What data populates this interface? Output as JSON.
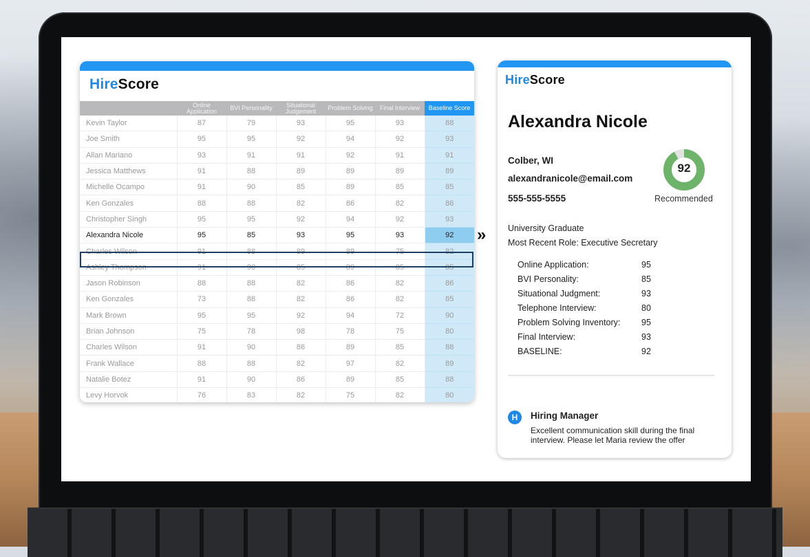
{
  "brand": {
    "hire": "Hire",
    "score": "Score"
  },
  "table": {
    "headers": [
      "Online Application",
      "BVI Personality",
      "Situational Judgement",
      "Problem Solving",
      "Final Interview",
      "Baseline Score"
    ],
    "rows": [
      [
        "Kevin Taylor",
        "87",
        "79",
        "93",
        "95",
        "93",
        "88"
      ],
      [
        "Joe Smith",
        "95",
        "95",
        "92",
        "94",
        "92",
        "93"
      ],
      [
        "Allan Mariano",
        "93",
        "91",
        "91",
        "92",
        "91",
        "91"
      ],
      [
        "Jessica Matthews",
        "91",
        "88",
        "89",
        "89",
        "89",
        "89"
      ],
      [
        "Michelle Ocampo",
        "91",
        "90",
        "85",
        "89",
        "85",
        "85"
      ],
      [
        "Ken Gonzales",
        "88",
        "88",
        "82",
        "86",
        "82",
        "86"
      ],
      [
        "Christopher Singh",
        "95",
        "95",
        "92",
        "94",
        "92",
        "93"
      ],
      [
        "Alexandra Nicole",
        "95",
        "85",
        "93",
        "95",
        "93",
        "92"
      ],
      [
        "Charles Wilson",
        "91",
        "88",
        "89",
        "89",
        "75",
        "82"
      ],
      [
        "Ashley Thompson",
        "91",
        "90",
        "85",
        "89",
        "85",
        "85"
      ],
      [
        "Jason Robinson",
        "88",
        "88",
        "82",
        "86",
        "82",
        "86"
      ],
      [
        "Ken Gonzales",
        "73",
        "88",
        "82",
        "86",
        "82",
        "85"
      ],
      [
        "Mark Brown",
        "95",
        "95",
        "92",
        "94",
        "72",
        "90"
      ],
      [
        "Brian Johnson",
        "75",
        "78",
        "98",
        "78",
        "75",
        "80"
      ],
      [
        "Charles Wilson",
        "91",
        "90",
        "86",
        "89",
        "85",
        "88"
      ],
      [
        "Frank Wallace",
        "88",
        "88",
        "82",
        "97",
        "82",
        "89"
      ],
      [
        "Natalie Botez",
        "91",
        "90",
        "86",
        "89",
        "85",
        "88"
      ],
      [
        "Levy Horvok",
        "76",
        "83",
        "82",
        "75",
        "82",
        "80"
      ]
    ],
    "selected_index": 7
  },
  "profile": {
    "name": "Alexandra Nicole",
    "location": "Colber, WI",
    "email": "alexandranicole@email.com",
    "phone": "555-555-5555",
    "score": "92",
    "score_fraction": 0.92,
    "score_color": "#6db36a",
    "status": "Recommended",
    "education": "University Graduate",
    "recent_role": "Most Recent Role: Executive Secretary",
    "scores": [
      {
        "label": "Online Application:",
        "value": "95"
      },
      {
        "label": "BVI Personality:",
        "value": "85"
      },
      {
        "label": "Situational Judgment:",
        "value": "93"
      },
      {
        "label": "Telephone Interview:",
        "value": "80"
      },
      {
        "label": "Problem Solving Inventory:",
        "value": "95"
      },
      {
        "label": "Final Interview:",
        "value": "93"
      },
      {
        "label": "BASELINE:",
        "value": "92"
      }
    ],
    "note": {
      "avatar": "H",
      "author": "Hiring Manager",
      "text": "Excellent communication skill during the final interview. Please let Maria review the offer"
    }
  },
  "colors": {
    "accent": "#2196f3",
    "baseline_cell": "#cfe9f8",
    "selected_outline": "#1d3f63"
  }
}
